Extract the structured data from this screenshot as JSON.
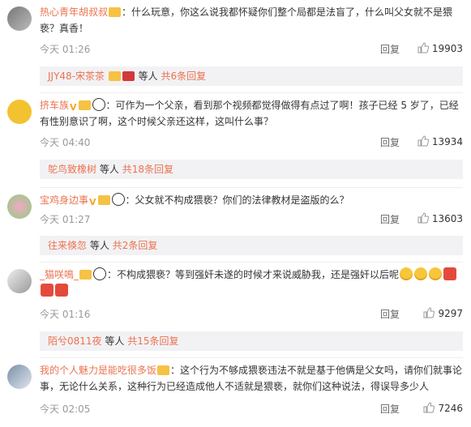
{
  "comments": [
    {
      "username": "热心青年胡叔叔",
      "text": "：什么玩意，你这么说我都怀疑你们整个局都是法盲了，什么叫父女就不是猥亵？真香！",
      "time": "今天 01:26",
      "reply_label": "回复",
      "likes": "19903",
      "replies": {
        "first_user": "JJY48-宋茶茶",
        "suffix_mid": "等人",
        "count_text": "共6条回复"
      }
    },
    {
      "username": "挤车族",
      "text": "：可作为一个父亲，看到那个视频都觉得做得有点过了啊！孩子已经 5 岁了，已经有性别意识了啊，这个时候父亲还这样，这叫什么事？",
      "time": "今天 04:40",
      "reply_label": "回复",
      "likes": "13934",
      "replies": {
        "first_user": "鸵鸟致橡树",
        "suffix_mid": "等人",
        "count_text": "共18条回复"
      }
    },
    {
      "username": "宝鸡身边事",
      "text": "：父女就不构成猥亵？你们的法律教材是盗版的么？",
      "time": "今天 01:27",
      "reply_label": "回复",
      "likes": "13603",
      "replies": {
        "first_user": "往来倏忽",
        "suffix_mid": "等人",
        "count_text": "共2条回复"
      }
    },
    {
      "username": "_猫咲鳴_",
      "text": "：不构成猥亵？等到强奸未遂的时候才来说威胁我，还是强奸以后呢",
      "time": "今天 01:16",
      "reply_label": "回复",
      "likes": "9297",
      "replies": {
        "first_user": "陌兮0811夜",
        "suffix_mid": "等人",
        "count_text": "共15条回复"
      }
    },
    {
      "username": "我的个人魅力是能吃很多饭",
      "text": "：这个行为不够成猥亵违法不就是基于他俩是父女吗，请你们就事论事，无论什么关系，这种行为已经造成他人不适就是猥亵，就你们这种说法，得误导多少人",
      "time": "今天 02:05",
      "reply_label": "回复",
      "likes": "7246"
    }
  ],
  "colors": {
    "username": "#eb7350",
    "reply_bg": "#f2f2f5",
    "meta": "#999999"
  },
  "icons": {
    "like": "thumbs-up-icon"
  }
}
